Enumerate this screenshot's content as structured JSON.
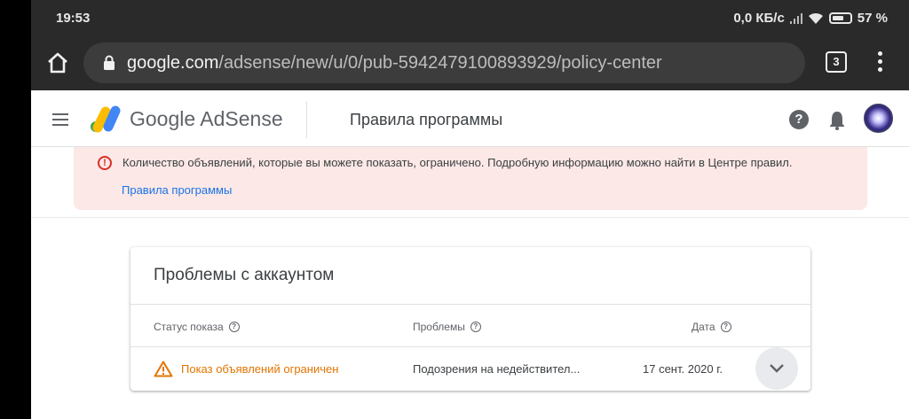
{
  "status_bar": {
    "time": "19:53",
    "speed": "0,0 КБ/с",
    "battery": "57 %"
  },
  "browser": {
    "url_host": "google.com",
    "url_path": "/adsense/new/u/0/pub-5942479100893929/policy-center",
    "tab_count": "3"
  },
  "header": {
    "brand": "Google AdSense",
    "page_title": "Правила программы",
    "help_glyph": "?"
  },
  "alert": {
    "icon_glyph": "!",
    "message": "Количество объявлений, которые вы можете показать, ограничено. Подробную информацию можно найти в Центре правил.",
    "link": "Правила программы"
  },
  "issues_card": {
    "title": "Проблемы с аккаунтом",
    "columns": {
      "status": "Статус показа",
      "issues": "Проблемы",
      "date": "Дата"
    },
    "help_glyph": "?",
    "rows": [
      {
        "status": "Показ объявлений ограничен",
        "issue": "Подозрения на недействител...",
        "date": "17 сент. 2020 г."
      }
    ]
  },
  "colors": {
    "alert_bg": "#fce8e6",
    "alert_icon": "#d93025",
    "link": "#1a73e8",
    "warning": "#e37400"
  },
  "icons": [
    "home-icon",
    "lock-icon",
    "tabs-icon",
    "more-vert-icon",
    "menu-icon",
    "adsense-logo-icon",
    "help-icon",
    "bell-icon",
    "error-icon",
    "warning-icon",
    "chevron-down-icon"
  ]
}
